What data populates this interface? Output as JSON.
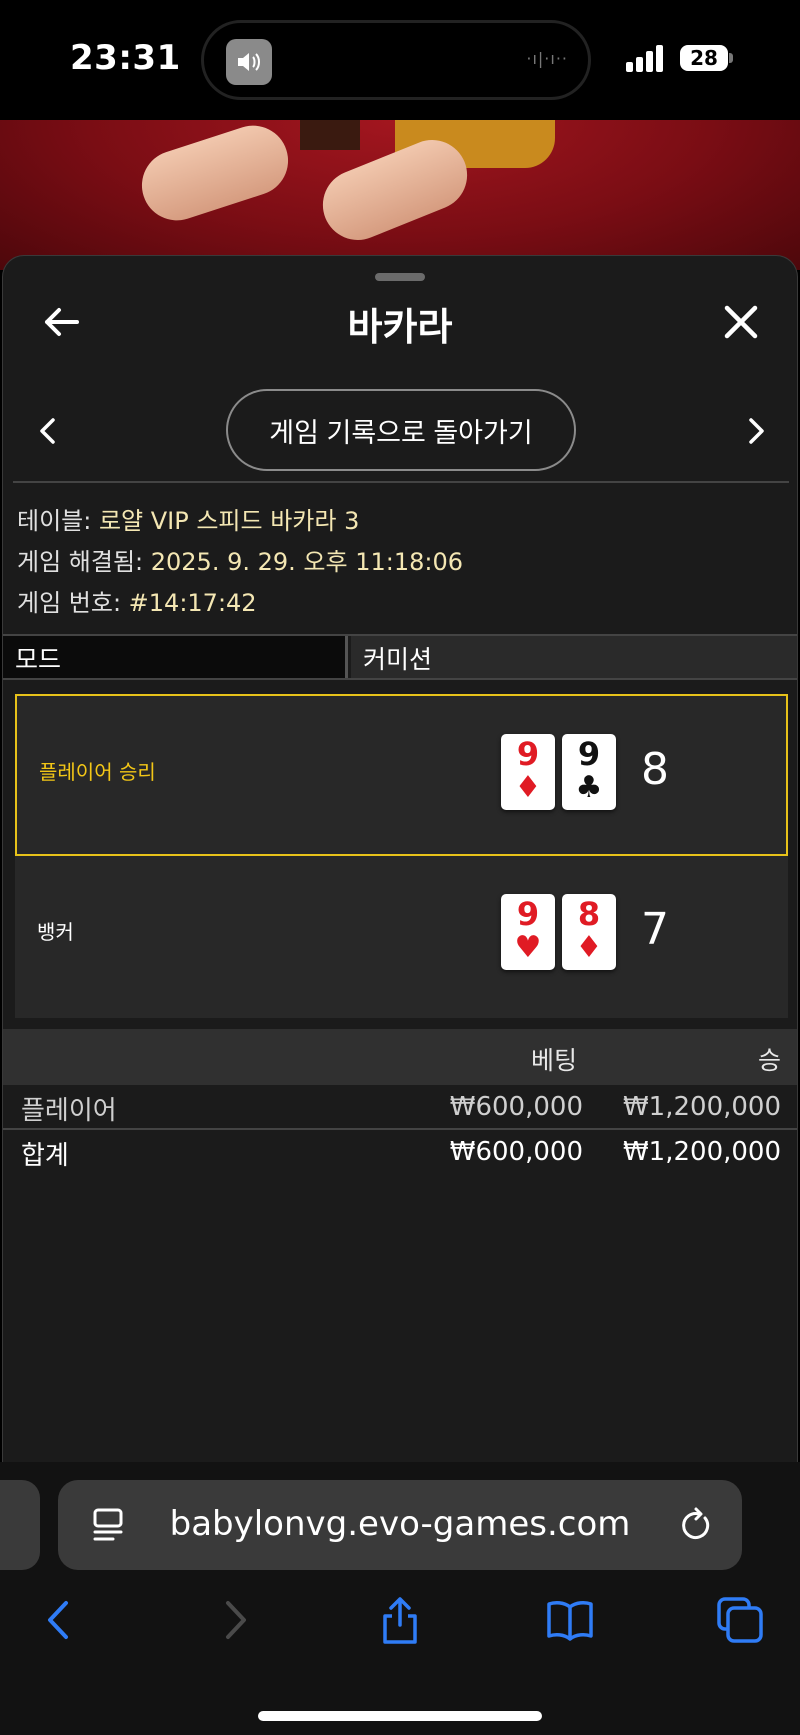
{
  "status": {
    "time": "23:31",
    "battery": "28"
  },
  "sheet": {
    "title": "바카라",
    "history_button": "게임 기록으로 돌아가기"
  },
  "info": {
    "table_label": "테이블: ",
    "table_value": "로얄 VIP 스피드 바카라 3",
    "resolved_label": "게임 해결됨: ",
    "resolved_value": "2025. 9. 29. 오후 11:18:06",
    "game_no_label": "게임 번호: ",
    "game_no_value": "#14:17:42"
  },
  "tabs": {
    "mode": "모드",
    "commission": "커미션"
  },
  "results": {
    "player": {
      "label": "플레이어 승리",
      "score": "8",
      "cards": [
        {
          "rank": "9",
          "suit": "♦",
          "color": "red"
        },
        {
          "rank": "9",
          "suit": "♣",
          "color": "black"
        }
      ]
    },
    "banker": {
      "label": "뱅커",
      "score": "7",
      "cards": [
        {
          "rank": "9",
          "suit": "♥",
          "color": "red"
        },
        {
          "rank": "8",
          "suit": "♦",
          "color": "red"
        }
      ]
    }
  },
  "bets": {
    "header_bet": "베팅",
    "header_win": "승",
    "rows": [
      {
        "name": "플레이어",
        "bet": "₩600,000",
        "win": "₩1,200,000"
      }
    ],
    "total": {
      "name": "합계",
      "bet": "₩600,000",
      "win": "₩1,200,000"
    }
  },
  "browser": {
    "url": "babylonvg.evo-games.com"
  },
  "colors": {
    "win_highlight": "#f2c617",
    "accent_blue": "#2f7cf6"
  }
}
